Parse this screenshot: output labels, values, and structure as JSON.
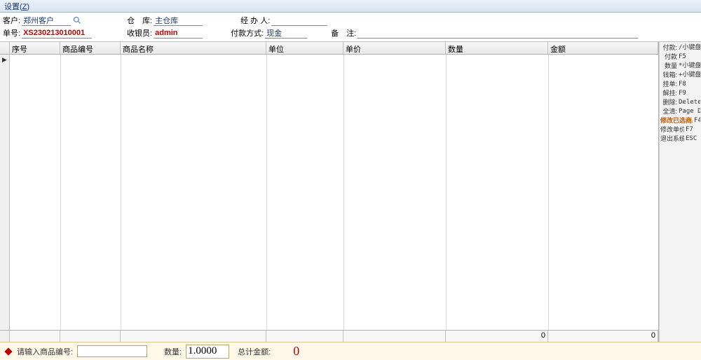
{
  "menubar": {
    "settings": "设置(Z)",
    "settings_mnemonic": "Z"
  },
  "form": {
    "customer_label": "客户:",
    "customer": "郑州客户",
    "warehouse_label": "仓　库:",
    "warehouse": "主仓库",
    "handler_label": "经 办 人:",
    "handler": "",
    "docno_label": "单号:",
    "docno": "XS230213010001",
    "cashier_label": "收银员:",
    "cashier": "admin",
    "paytype_label": "付款方式:",
    "paytype": "现金",
    "remark_label": "备　注:",
    "remark": ""
  },
  "gridHeaders": {
    "seq": "序号",
    "code": "商品编号",
    "name": "商品名称",
    "unit": "单位",
    "price": "单价",
    "qty": "数量",
    "amount": "金额"
  },
  "gridFooter": {
    "qty_total": "0",
    "amount_total": "0"
  },
  "shortcuts": [
    {
      "label": "付款:",
      "key": "/小键盘",
      "em": false
    },
    {
      "label": "付款",
      "key": "F5",
      "em": false
    },
    {
      "label": "数量",
      "key": "*小键盘",
      "em": false
    },
    {
      "label": "钱箱:",
      "key": "+小键盘",
      "em": false
    },
    {
      "label": "挂单:",
      "key": "F8",
      "em": false
    },
    {
      "label": "解挂:",
      "key": "F9",
      "em": false
    },
    {
      "label": "删除:",
      "key": "Delete",
      "em": false
    },
    {
      "label": "全清:",
      "key": "Page Down",
      "em": false
    },
    {
      "label": "修改已选商品数量",
      "key": "F4",
      "em": true
    },
    {
      "label": "修改单价:",
      "key": "F7",
      "em": false
    },
    {
      "label": "退出系统:",
      "key": "ESC",
      "em": false
    }
  ],
  "bottom": {
    "prompt": "请输入商品编号:",
    "code": "",
    "qty_label": "数量:",
    "qty": "1.0000",
    "total_label": "总计金额:",
    "total": "0"
  }
}
